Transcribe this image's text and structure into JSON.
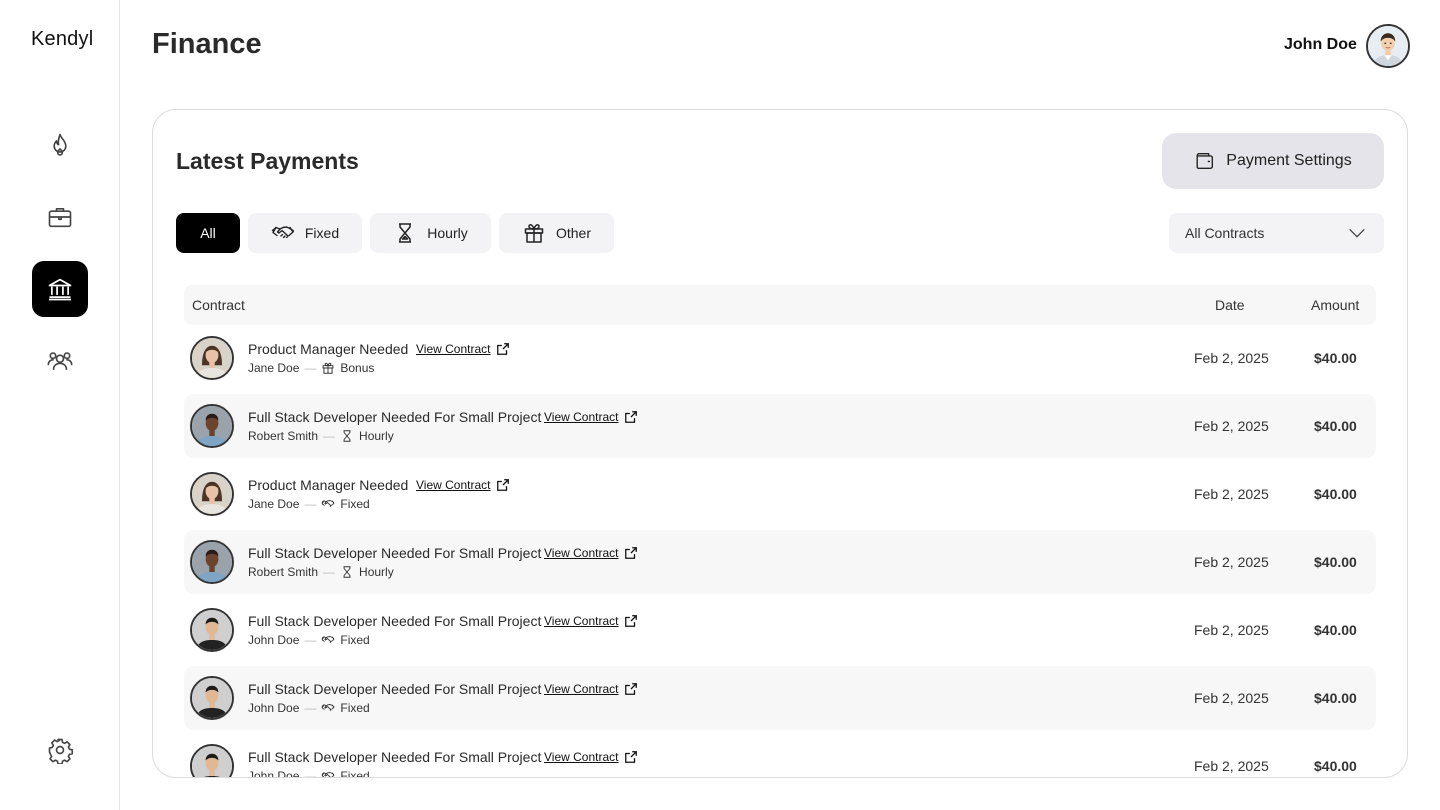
{
  "app": {
    "logo": "Kendyl",
    "page_title": "Finance"
  },
  "user": {
    "name": "John Doe"
  },
  "sidebar": {
    "items": [
      {
        "name": "fire-icon",
        "active": false
      },
      {
        "name": "briefcase-icon",
        "active": false
      },
      {
        "name": "bank-icon",
        "active": true
      },
      {
        "name": "users-icon",
        "active": false
      },
      {
        "name": "gear-icon",
        "active": false
      }
    ]
  },
  "payments": {
    "title": "Latest Payments",
    "settings_label": "Payment Settings",
    "tabs": [
      {
        "label": "All",
        "icon": "",
        "active": true
      },
      {
        "label": "Fixed",
        "icon": "handshake-icon",
        "active": false
      },
      {
        "label": "Hourly",
        "icon": "hourglass-icon",
        "active": false
      },
      {
        "label": "Other",
        "icon": "gift-icon",
        "active": false
      }
    ],
    "filter": {
      "selected": "All Contracts"
    },
    "columns": {
      "contract": "Contract",
      "date": "Date",
      "amount": "Amount"
    },
    "link_label": "View Contract",
    "rows": [
      {
        "title": "Product Manager Needed",
        "person": "Jane Doe",
        "type": "Bonus",
        "type_icon": "gift-icon",
        "date": "Feb 2, 2025",
        "amount": "$40.00"
      },
      {
        "title": "Full Stack Developer Needed For Small Project",
        "person": "Robert Smith",
        "type": "Hourly",
        "type_icon": "hourglass-icon",
        "date": "Feb 2, 2025",
        "amount": "$40.00"
      },
      {
        "title": "Product Manager Needed",
        "person": "Jane Doe",
        "type": "Fixed",
        "type_icon": "handshake-icon",
        "date": "Feb 2, 2025",
        "amount": "$40.00"
      },
      {
        "title": "Full Stack Developer Needed For Small Project",
        "person": "Robert Smith",
        "type": "Hourly",
        "type_icon": "hourglass-icon",
        "date": "Feb 2, 2025",
        "amount": "$40.00"
      },
      {
        "title": "Full Stack Developer Needed For Small Project",
        "person": "John Doe",
        "type": "Fixed",
        "type_icon": "handshake-icon",
        "date": "Feb 2, 2025",
        "amount": "$40.00"
      },
      {
        "title": "Full Stack Developer Needed For Small Project",
        "person": "John Doe",
        "type": "Fixed",
        "type_icon": "handshake-icon",
        "date": "Feb 2, 2025",
        "amount": "$40.00"
      },
      {
        "title": "Full Stack Developer Needed For Small Project",
        "person": "John Doe",
        "type": "Fixed",
        "type_icon": "handshake-icon",
        "date": "Feb 2, 2025",
        "amount": "$40.00"
      }
    ]
  },
  "colors": {
    "active_nav": "#000000",
    "button_bg": "#e4e4ea",
    "tab_bg": "#f3f3f5",
    "row_alt": "#f7f7f8"
  }
}
